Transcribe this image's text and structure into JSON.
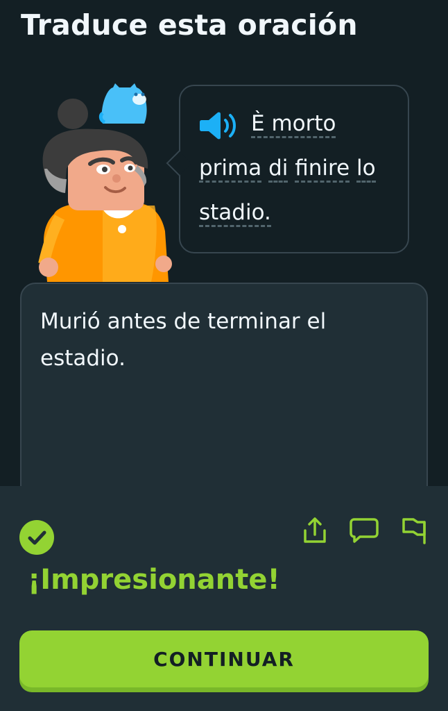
{
  "header": {
    "title": "Traduce esta oración"
  },
  "prompt": {
    "audio_icon": "speaker-icon",
    "line1": "È morto",
    "line2_word1": "prima",
    "line2_word2": "di",
    "line2_word3": "finire",
    "line2_word4": "lo",
    "line3": "stadio."
  },
  "answer": {
    "text": "Murió antes de terminar el estadio."
  },
  "feedback": {
    "status_icon": "checkmark-icon",
    "actions": [
      "share-icon",
      "comment-icon",
      "flag-icon"
    ],
    "message": "¡Impresionante!",
    "continue_label": "CONTINUAR"
  },
  "colors": {
    "background": "#131f24",
    "panel": "#202f36",
    "border": "#37464f",
    "accent_green": "#93d333",
    "accent_blue": "#1cb0f6"
  }
}
